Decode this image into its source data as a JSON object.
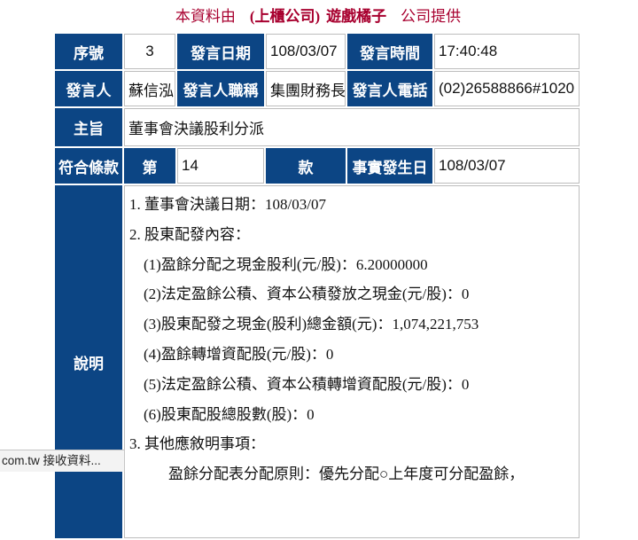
{
  "header": {
    "prefix": "本資料由",
    "market_type": "(上櫃公司)",
    "company": "遊戲橘子",
    "suffix": "公司提供"
  },
  "table": {
    "row1": {
      "seq_label": "序號",
      "seq": "3",
      "date_label": "發言日期",
      "date": "108/03/07",
      "time_label": "發言時間",
      "time": "17:40:48"
    },
    "row2": {
      "spokesperson_label": "發言人",
      "spokesperson": "蘇信泓",
      "title_label": "發言人職稱",
      "title": "集團財務長",
      "phone_label": "發言人電話",
      "phone": "(02)26588866#1020"
    },
    "row3": {
      "subject_label": "主旨",
      "subject": "董事會決議股利分派"
    },
    "row4": {
      "clause_label": "符合條款",
      "clause_prefix": "第",
      "clause_number": "14",
      "clause_suffix": "款",
      "fact_date_label": "事實發生日",
      "fact_date": "108/03/07"
    },
    "description": {
      "label": "說明",
      "lines": [
        "1. 董事會決議日期：108/03/07",
        "2. 股東配發內容：",
        "(1)盈餘分配之現金股利(元/股)：6.20000000",
        "(2)法定盈餘公積、資本公積發放之現金(元/股)：0",
        "(3)股東配發之現金(股利)總金額(元)：1,074,221,753",
        "(4)盈餘轉增資配股(元/股)：0",
        "(5)法定盈餘公積、資本公積轉增資配股(元/股)：0",
        "(6)股東配股總股數(股)：0",
        "3. 其他應敘明事項：",
        "盈餘分配表分配原則：優先分配○上年度可分配盈餘，"
      ]
    }
  },
  "status_bar": {
    "text": "com.tw 接收資料..."
  },
  "colors": {
    "header_cell_bg": "#0c4584",
    "title_text": "#a8002f",
    "cell_border": "#bdbdbd"
  }
}
